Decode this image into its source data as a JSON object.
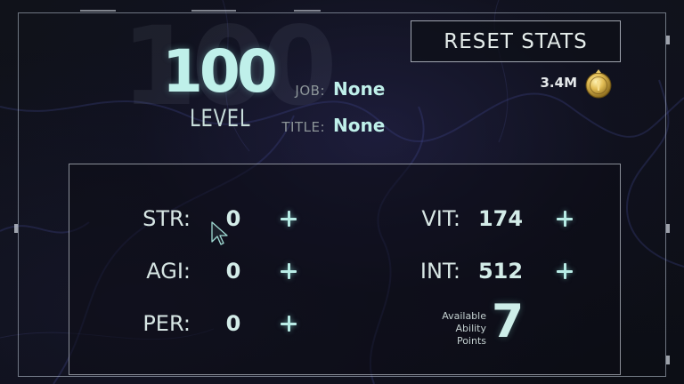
{
  "status": {
    "level_number": "100",
    "level_label": "LEVEL",
    "job_label": "JOB:",
    "job_value": "None",
    "title_label": "TITLE:",
    "title_value": "None"
  },
  "actions": {
    "reset_label": "RESET STATS"
  },
  "currency": {
    "amount": "3.4M",
    "icon": "gold-coin-icon"
  },
  "stats": {
    "str": {
      "label": "STR:",
      "value": "0"
    },
    "agi": {
      "label": "AGI:",
      "value": "0"
    },
    "per": {
      "label": "PER:",
      "value": "0"
    },
    "vit": {
      "label": "VIT:",
      "value": "174"
    },
    "int": {
      "label": "INT:",
      "value": "512"
    }
  },
  "ability_points": {
    "label_line1": "Available",
    "label_line2": "Ability",
    "label_line3": "Points",
    "value": "7"
  },
  "colors": {
    "accent": "#bff0ea",
    "text": "#d7e6e4",
    "muted": "#8d9699",
    "background": "#0e1016",
    "frame": "#c8cdd6",
    "coin_gold": "#d9b54a"
  }
}
